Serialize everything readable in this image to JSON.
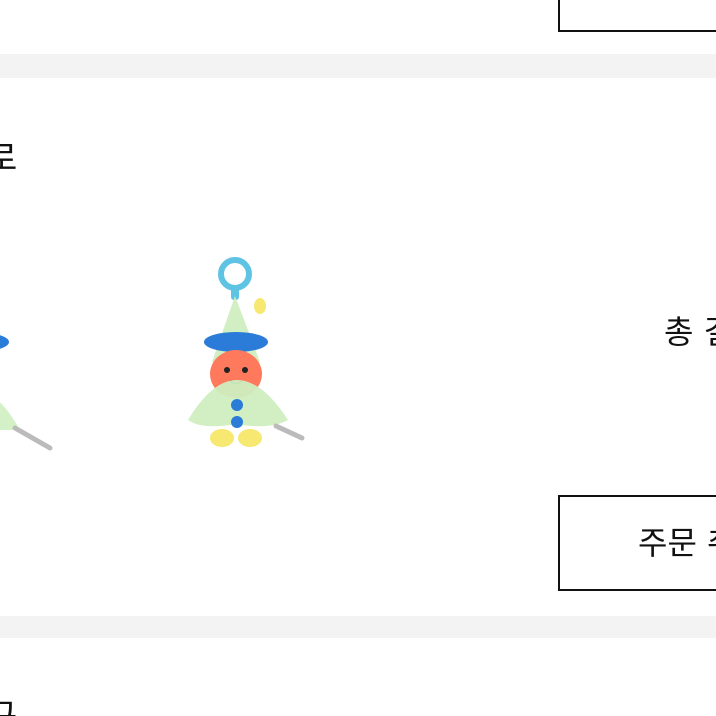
{
  "top_card": {
    "button_label": ""
  },
  "order_card": {
    "title": "로",
    "products": [
      {
        "name": "character-keyring"
      },
      {
        "name": "character-keyring"
      }
    ],
    "total_label": "총 결",
    "order_button_label": "주문 취"
  },
  "bottom_card": {
    "title": "구"
  },
  "colors": {
    "divider": "#f3f3f3",
    "border": "#111111",
    "raincoat": "#cfeec0",
    "hat_accent": "#2b7bd8",
    "face": "#ff7a5c",
    "ring": "#5fc3e4"
  }
}
